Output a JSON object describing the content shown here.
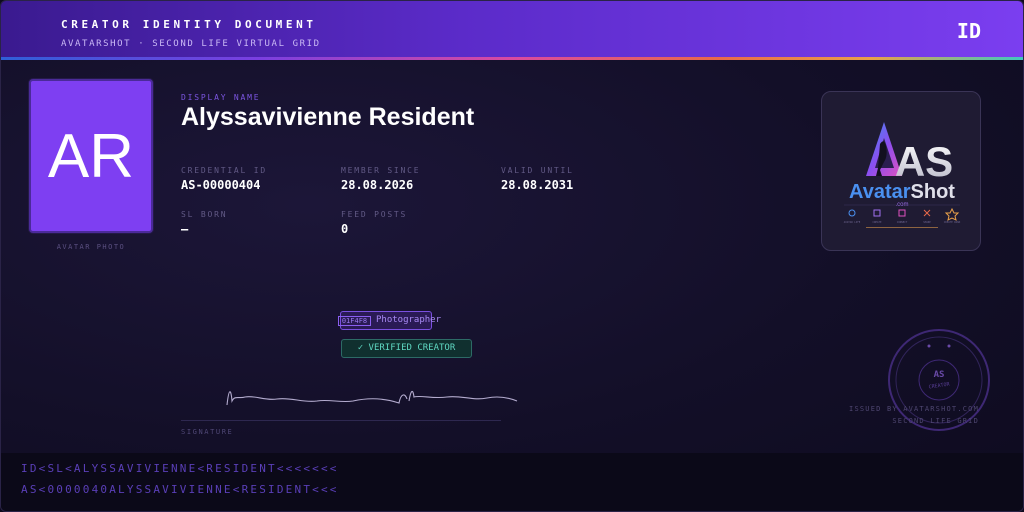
{
  "header": {
    "title": "CREATOR IDENTITY DOCUMENT",
    "subtitle": "AVATARSHOT · SECOND LIFE VIRTUAL GRID",
    "badge": "ID"
  },
  "photo": {
    "initials": "AR",
    "label": "AVATAR PHOTO",
    "color": "#7e3ff2"
  },
  "fields": {
    "display_name_label": "DISPLAY NAME",
    "display_name": "Alyssavivienne Resident",
    "credential_id_label": "CREDENTIAL ID",
    "credential_id": "AS-00000404",
    "member_since_label": "MEMBER SINCE",
    "member_since": "28.08.2026",
    "valid_until_label": "VALID UNTIL",
    "valid_until": "28.08.2031",
    "sl_born_label": "SL BORN",
    "sl_born": "—",
    "feed_posts_label": "FEED POSTS",
    "feed_posts": "0"
  },
  "logo": {
    "mark": "AS",
    "brand_a": "Avatar",
    "brand_b": "Shot",
    "domain": ".com"
  },
  "tags": {
    "role_code": "01F4F8",
    "role": "Photographer",
    "verified": "✓ VERIFIED CREATOR"
  },
  "signature": {
    "label": "SIGNATURE"
  },
  "stamp": {
    "mark": "AS",
    "text": "CREATOR",
    "issued_line1": "ISSUED BY AVATARSHOT.COM",
    "issued_line2": "SECOND LIFE GRID"
  },
  "mrz": {
    "line1": "ID<SL<ALYSSAVIVIENNE<RESIDENT<<<<<<<",
    "line2": "AS<0000040ALYSSAVIVIENNE<RESIDENT<<<"
  },
  "colors": {
    "accent": "#7b3ef0",
    "verified": "#5fd8c2",
    "mrz": "#5a3fb8"
  }
}
